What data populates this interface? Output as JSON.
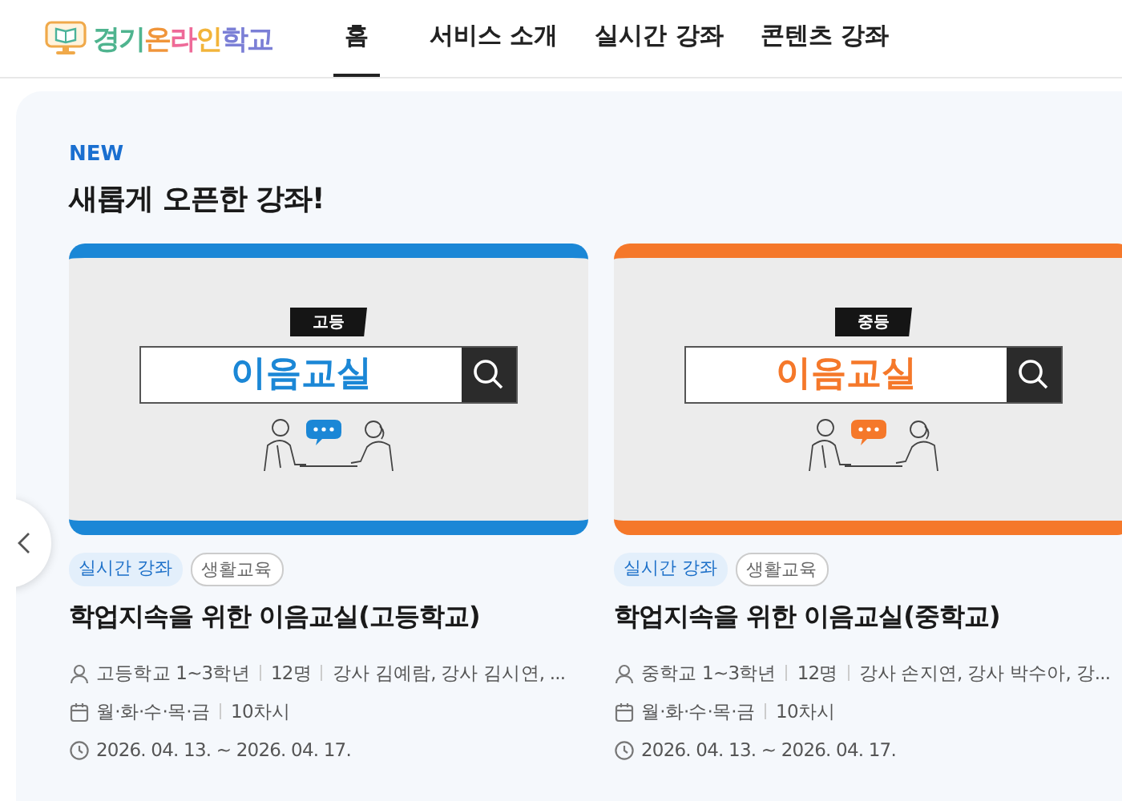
{
  "header": {
    "logo": "경기온라인학교",
    "nav": [
      {
        "label": "홈",
        "selected": true
      },
      {
        "label": "서비스 소개",
        "selected": false
      },
      {
        "label": "실시간 강좌",
        "selected": false
      },
      {
        "label": "콘텐츠 강좌",
        "selected": false
      }
    ]
  },
  "section": {
    "eyebrow": "NEW",
    "title": "새롭게 오픈한 강좌!",
    "courses": [
      {
        "color": "#1b87d6",
        "thumbnail": {
          "tag": "고등",
          "banner": "이음교실"
        },
        "tags": [
          {
            "label": "실시간 강좌",
            "kind": "type"
          },
          {
            "label": "생활교육",
            "kind": "category"
          }
        ],
        "title": "학업지속을 위한 이음교실(고등학교)",
        "meta": [
          {
            "kind": "audience",
            "parts": [
              "고등학교 1~3학년",
              "12명",
              "강사 김예람, 강사 김시연, ..."
            ]
          },
          {
            "kind": "schedule",
            "parts": [
              "월·화·수·목·금",
              "10차시"
            ]
          },
          {
            "kind": "period",
            "parts": [
              "2026. 04. 13. ~ 2026. 04. 17."
            ]
          }
        ]
      },
      {
        "color": "#f5782a",
        "thumbnail": {
          "tag": "중등",
          "banner": "이음교실"
        },
        "tags": [
          {
            "label": "실시간 강좌",
            "kind": "type"
          },
          {
            "label": "생활교육",
            "kind": "category"
          }
        ],
        "title": "학업지속을 위한 이음교실(중학교)",
        "meta": [
          {
            "kind": "audience",
            "parts": [
              "중학교 1~3학년",
              "12명",
              "강사 손지연, 강사 박수아, 강..."
            ]
          },
          {
            "kind": "schedule",
            "parts": [
              "월·화·수·목·금",
              "10차시"
            ]
          },
          {
            "kind": "period",
            "parts": [
              "2026. 04. 13. ~ 2026. 04. 17."
            ]
          }
        ]
      }
    ]
  }
}
